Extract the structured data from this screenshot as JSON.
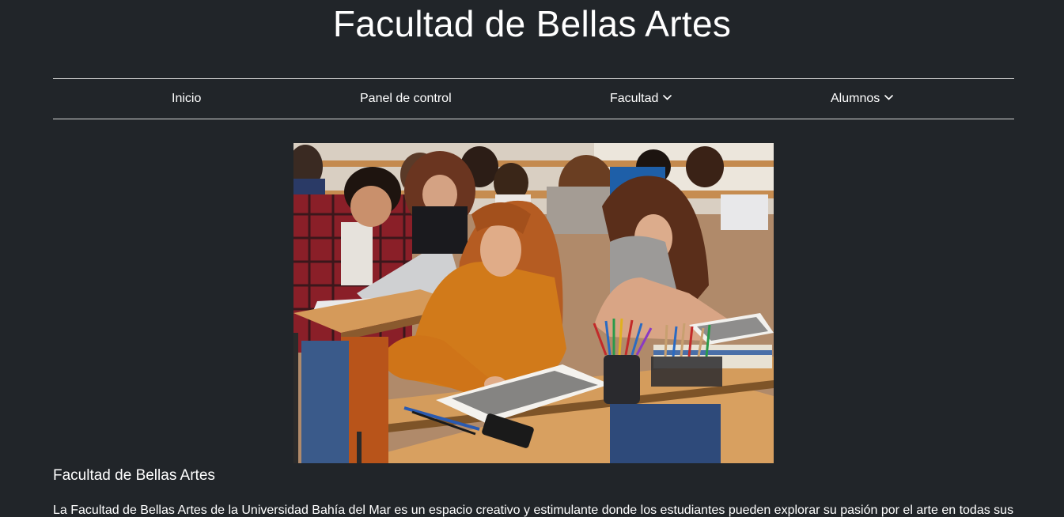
{
  "site": {
    "title": "Facultad de Bellas Artes"
  },
  "nav": {
    "items": [
      {
        "label": "Inicio",
        "has_dropdown": false
      },
      {
        "label": "Panel de control",
        "has_dropdown": false
      },
      {
        "label": "Facultad",
        "has_dropdown": true,
        "icon": "chevron-down-icon"
      },
      {
        "label": "Alumnos",
        "has_dropdown": true,
        "icon": "chevron-down-icon"
      }
    ]
  },
  "main": {
    "image_subject": "Students drawing in sketchbooks at classroom desks",
    "section_title": "Facultad de Bellas Artes",
    "intro": "La Facultad de Bellas Artes de la Universidad Bahía del Mar es un espacio creativo y estimulante donde los estudiantes pueden explorar su pasión por el arte en todas sus"
  },
  "colors": {
    "background": "#212529",
    "text": "#ffffff",
    "divider": "#d8d8d8"
  }
}
